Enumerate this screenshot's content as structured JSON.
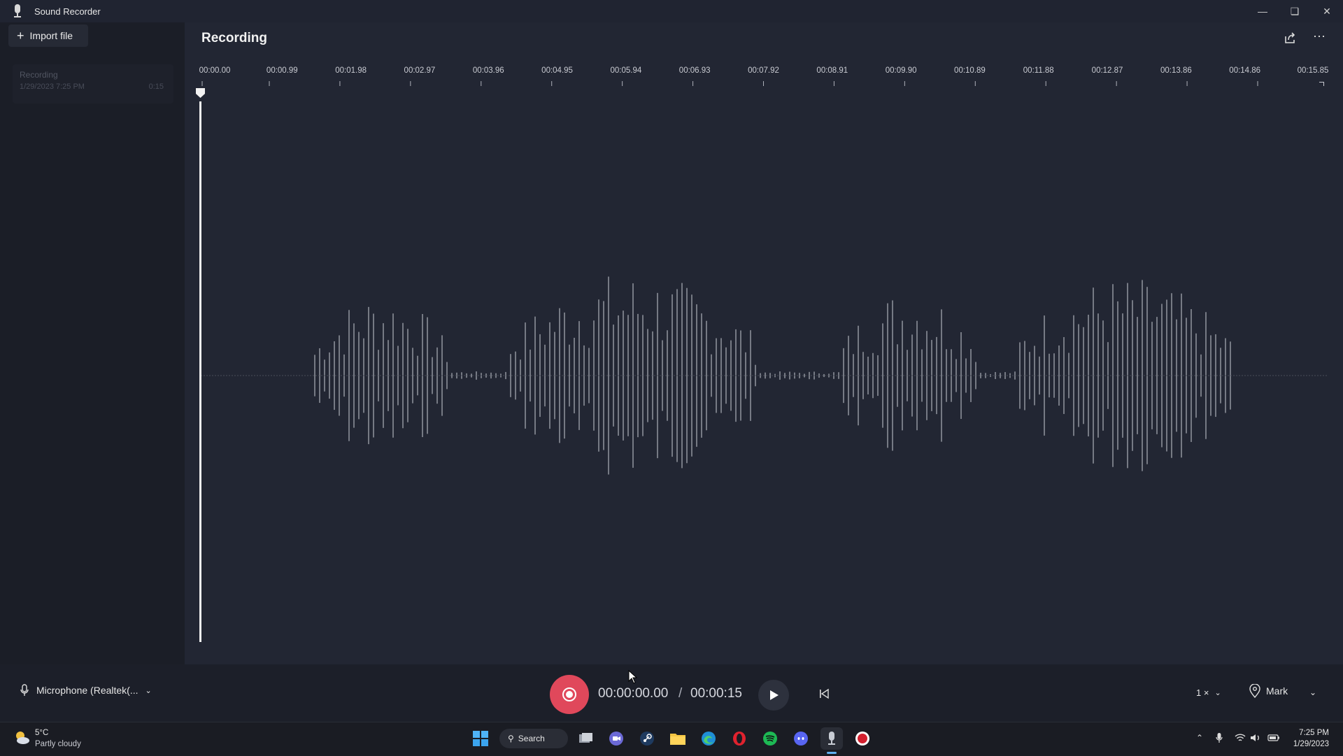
{
  "window": {
    "title": "Sound Recorder"
  },
  "sidebar": {
    "import_label": "Import file",
    "recording_item": {
      "title": "Recording",
      "date": "1/29/2023 7:25 PM",
      "length": "0:15"
    }
  },
  "main": {
    "title": "Recording",
    "timeline_ticks": [
      "00:00.00",
      "00:00.99",
      "00:01.98",
      "00:02.97",
      "00:03.96",
      "00:04.95",
      "00:05.94",
      "00:06.93",
      "00:07.92",
      "00:08.91",
      "00:09.90",
      "00:10.89",
      "00:11.88",
      "00:12.87",
      "00:13.86",
      "00:14.86",
      "00:15.85"
    ]
  },
  "playback": {
    "microphone": "Microphone (Realtek(...",
    "current_time": "00:00:00.00",
    "separator": "/",
    "total_time": "00:00:15",
    "speed": "1 ×",
    "mark_label": "Mark"
  },
  "taskbar": {
    "weather_temp": "5°C",
    "weather_desc": "Partly cloudy",
    "search_label": "Search",
    "clock_time": "7:25 PM",
    "clock_date": "1/29/2023"
  },
  "colors": {
    "record": "#e0485b",
    "background": "#222633",
    "waveform": "#8c8f99"
  }
}
